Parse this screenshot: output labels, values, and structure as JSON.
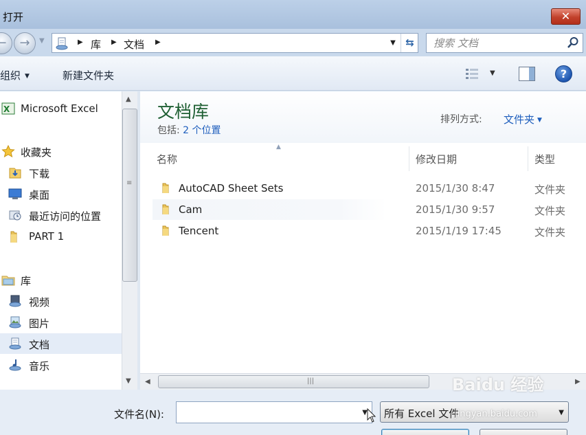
{
  "window": {
    "title": "打开",
    "close_glyph": "✕"
  },
  "address": {
    "breadcrumbs": [
      "库",
      "文档"
    ],
    "search_placeholder": "搜索 文档"
  },
  "toolbar": {
    "organize": "组织",
    "new_folder": "新建文件夹",
    "help": "?"
  },
  "sidebar": {
    "items": [
      {
        "label": "Microsoft Excel",
        "icon": "excel-icon"
      },
      {
        "label": "收藏夹",
        "icon": "star-icon"
      },
      {
        "label": "下载",
        "icon": "download-folder-icon"
      },
      {
        "label": "桌面",
        "icon": "desktop-icon"
      },
      {
        "label": "最近访问的位置",
        "icon": "recent-places-icon"
      },
      {
        "label": "PART 1",
        "icon": "folder-icon"
      },
      {
        "label": "库",
        "icon": "library-icon"
      },
      {
        "label": "视频",
        "icon": "video-library-icon"
      },
      {
        "label": "图片",
        "icon": "pictures-library-icon"
      },
      {
        "label": "文档",
        "icon": "documents-library-icon",
        "selected": true
      },
      {
        "label": "音乐",
        "icon": "music-library-icon"
      }
    ]
  },
  "library": {
    "title": "文档库",
    "includes_label": "包括:",
    "includes_link": "2 个位置",
    "arrange_label": "排列方式:",
    "arrange_value": "文件夹"
  },
  "columns": {
    "name": "名称",
    "date": "修改日期",
    "type": "类型"
  },
  "files": [
    {
      "name": "AutoCAD Sheet Sets",
      "date": "2015/1/30 8:47",
      "type": "文件夹"
    },
    {
      "name": "Cam",
      "date": "2015/1/30 9:57",
      "type": "文件夹"
    },
    {
      "name": "Tencent",
      "date": "2015/1/19 17:45",
      "type": "文件夹"
    }
  ],
  "bottom": {
    "filename_label": "文件名(N):",
    "filename_value": "",
    "filetype_value": "所有 Excel 文件"
  },
  "watermark": {
    "logo": "Baidu 经验",
    "url": "jingyan.baidu.com"
  },
  "colors": {
    "accent": "#1e5ebd",
    "library_title": "#1e5f32",
    "close": "#c2412b"
  }
}
